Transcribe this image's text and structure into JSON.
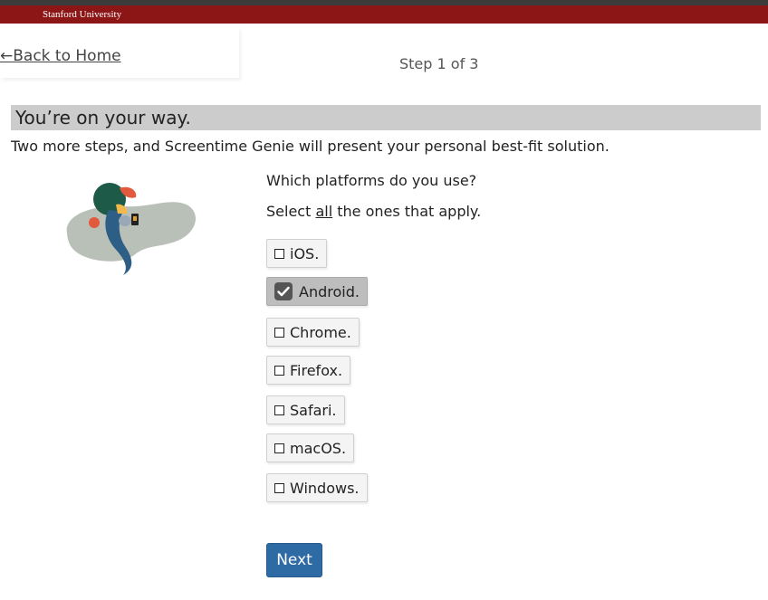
{
  "header": {
    "brand": "Stanford University"
  },
  "nav": {
    "back_label": "←Back to Home",
    "step_label": "Step 1 of 3"
  },
  "banner": {
    "title": "You’re on your way."
  },
  "intro": {
    "subtitle": "Two more steps, and Screentime Genie will present your personal best-fit solution."
  },
  "form": {
    "question": "Which platforms do you use?",
    "instruction_prefix": "Select ",
    "instruction_emphasis": "all",
    "instruction_suffix": " the ones that apply.",
    "options": [
      {
        "label": "iOS.",
        "checked": false
      },
      {
        "label": "Android.",
        "checked": true
      },
      {
        "label": "Chrome.",
        "checked": false
      },
      {
        "label": "Firefox.",
        "checked": false
      },
      {
        "label": "Safari.",
        "checked": false
      },
      {
        "label": "macOS.",
        "checked": false
      },
      {
        "label": "Windows.",
        "checked": false
      }
    ],
    "next_label": "Next"
  },
  "colors": {
    "brand_red": "#8c1515",
    "banner_gray": "#cccccc",
    "next_blue": "#2e6aa4",
    "checked_bg": "#bdbdbd"
  },
  "icons": {
    "illustration": "genie-illustration",
    "checkmark": "checkmark-icon"
  }
}
